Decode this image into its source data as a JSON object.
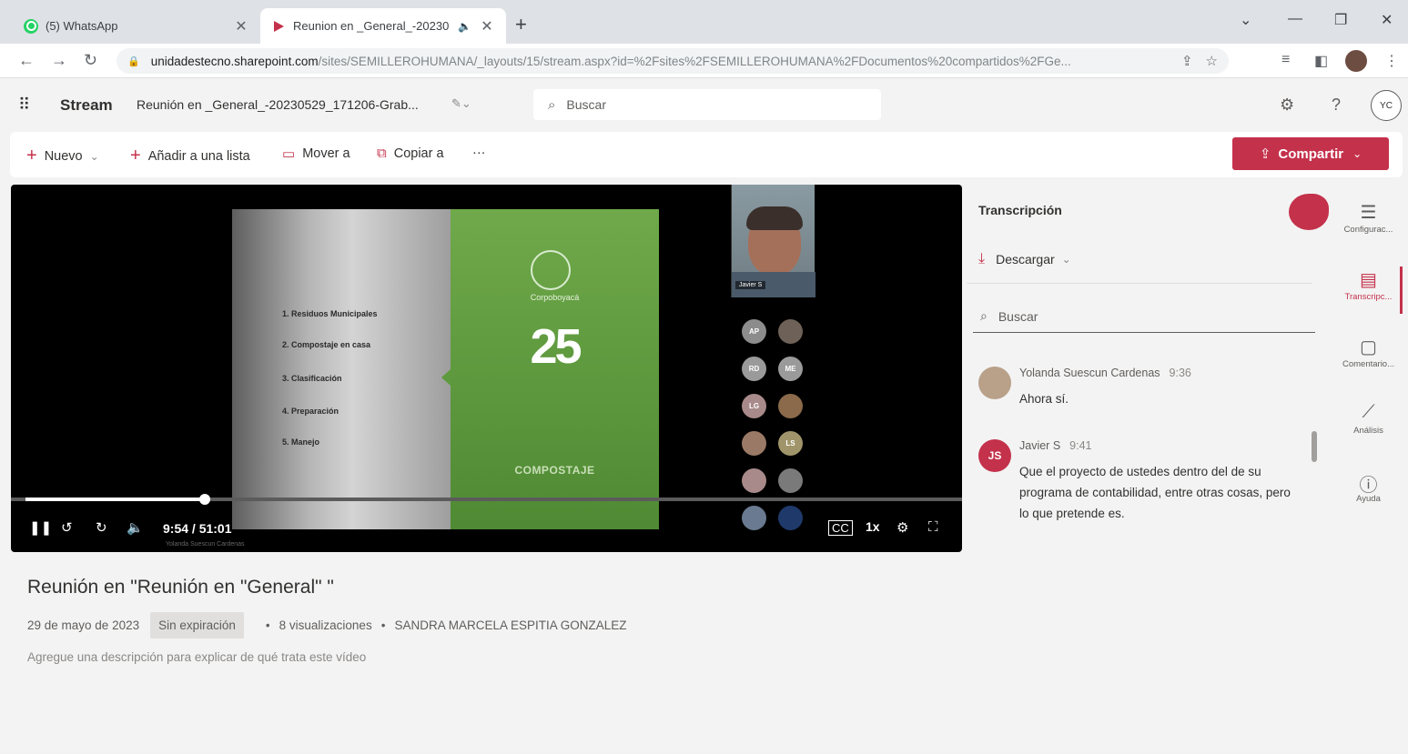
{
  "browser": {
    "tabs": [
      {
        "title": "(5) WhatsApp",
        "active": false,
        "icon": "whatsapp-icon"
      },
      {
        "title": "Reunion en _General_-20230",
        "active": true,
        "icon": "stream-icon"
      }
    ],
    "new_tab": "+",
    "url_domain": "unidadestecno.sharepoint.com",
    "url_path": "/sites/SEMILLEROHUMANA/_layouts/15/stream.aspx?id=%2Fsites%2FSEMILLEROHUMANA%2FDocumentos%20compartidos%2FGe..."
  },
  "app": {
    "name": "Stream",
    "file_name": "Reunión en _General_-20230529_171206-Grab...",
    "search_placeholder": "Buscar",
    "user_initials": "YC",
    "accent": "#c4314b"
  },
  "commands": {
    "new": "Nuevo",
    "add_to_list": "Añadir a una lista",
    "move": "Mover a",
    "copy": "Copiar a",
    "more": "···",
    "share": "Compartir"
  },
  "video": {
    "elapsed": "9:54",
    "duration": "51:01",
    "time_display": "9:54 / 51:01",
    "progress": 0.194,
    "speed": "1x",
    "slide_items": [
      "1. Residuos Municipales",
      "2. Compostaje en casa",
      "3. Clasificación",
      "4. Preparación",
      "5. Manejo"
    ],
    "slide_brand": "Corpoboyacá",
    "slide_number": "25",
    "slide_footer": "COMPOSTAJE",
    "camera_label": "Javier S",
    "participants": [
      "AP",
      "",
      "RD",
      "ME",
      "LG",
      "",
      "",
      "LS",
      "",
      "",
      "",
      ""
    ],
    "speaker_caption": "Yolanda Suescun Cardenas"
  },
  "details": {
    "title": "Reunión en \"Reunión en \"General\" \"",
    "date": "29 de mayo de 2023",
    "expiration_badge": "Sin expiración",
    "views": "8 visualizaciones",
    "owner": "SANDRA MARCELA ESPITIA GONZALEZ",
    "description_placeholder": "Agregue una descripción para explicar de qué trata este vídeo"
  },
  "transcript": {
    "title": "Transcripción",
    "download": "Descargar",
    "search_placeholder": "Buscar",
    "entries": [
      {
        "speaker": "Yolanda Suescun Cardenas",
        "time": "9:36",
        "text": "Ahora sí.",
        "initials": "",
        "avatar_color": "#b8a089"
      },
      {
        "speaker": "Javier S",
        "time": "9:41",
        "text": "Que el proyecto de ustedes dentro del de su programa de contabilidad, entre otras cosas, pero lo que pretende es.",
        "initials": "JS",
        "avatar_color": "#c4314b"
      }
    ]
  },
  "rail": [
    {
      "label": "Configurac...",
      "icon": "settings-panel-icon",
      "active": false
    },
    {
      "label": "Transcripc...",
      "icon": "transcript-icon",
      "active": true
    },
    {
      "label": "Comentario...",
      "icon": "comment-icon",
      "active": false
    },
    {
      "label": "Análisis",
      "icon": "analytics-icon",
      "active": false
    },
    {
      "label": "Ayuda",
      "icon": "help-icon",
      "active": false
    }
  ]
}
